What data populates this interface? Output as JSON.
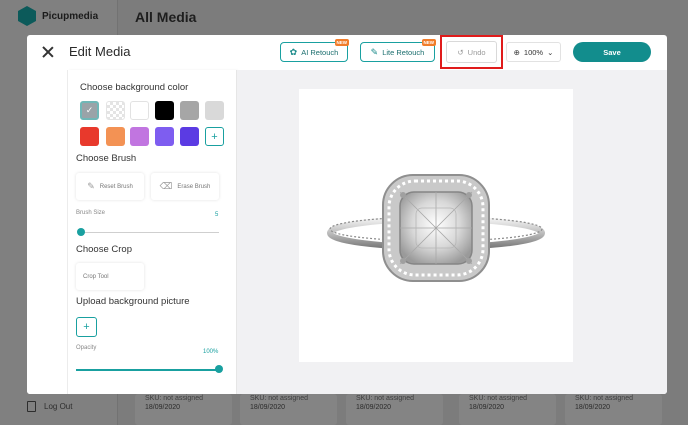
{
  "app": {
    "name": "Picupmedia",
    "page_title": "All Media",
    "logout_label": "Log Out"
  },
  "background_cards": [
    {
      "sku": "SKU: not assigned",
      "date": "18/09/2020"
    },
    {
      "sku": "SKU: not assigned",
      "date": "18/09/2020"
    },
    {
      "sku": "SKU: not assigned",
      "date": "18/09/2020"
    },
    {
      "sku": "SKU: not assigned",
      "date": "18/09/2020"
    },
    {
      "sku": "SKU: not assigned",
      "date": "18/09/2020"
    }
  ],
  "modal": {
    "title": "Edit Media",
    "ai_retouch_label": "AI Retouch",
    "lite_retouch_label": "Lite Retouch",
    "new_badge": "NEW",
    "undo_label": "Undo",
    "zoom_value": "100%",
    "save_label": "Save"
  },
  "panel": {
    "bg_color_title": "Choose background color",
    "colors": [
      "#9aa3a8",
      "checker",
      "#ffffff",
      "#000000",
      "#a6a6a6",
      "#d9d9d9",
      "#e8392c",
      "#f39254",
      "#c175e0",
      "#7e5df0",
      "#5b3be3"
    ],
    "add_color_symbol": "+",
    "brush_title": "Choose Brush",
    "reset_brush_label": "Reset Brush",
    "erase_brush_label": "Erase Brush",
    "brush_size_label": "Brush Size",
    "brush_size_value": "5",
    "crop_title": "Choose Crop",
    "crop_tool_label": "Crop Tool",
    "upload_title": "Upload background picture",
    "upload_symbol": "+",
    "opacity_label": "Opacity",
    "opacity_value": "100%"
  },
  "colors": {
    "accent": "#19a0a0",
    "save": "#128d8d",
    "highlight": "#e01b1b"
  }
}
